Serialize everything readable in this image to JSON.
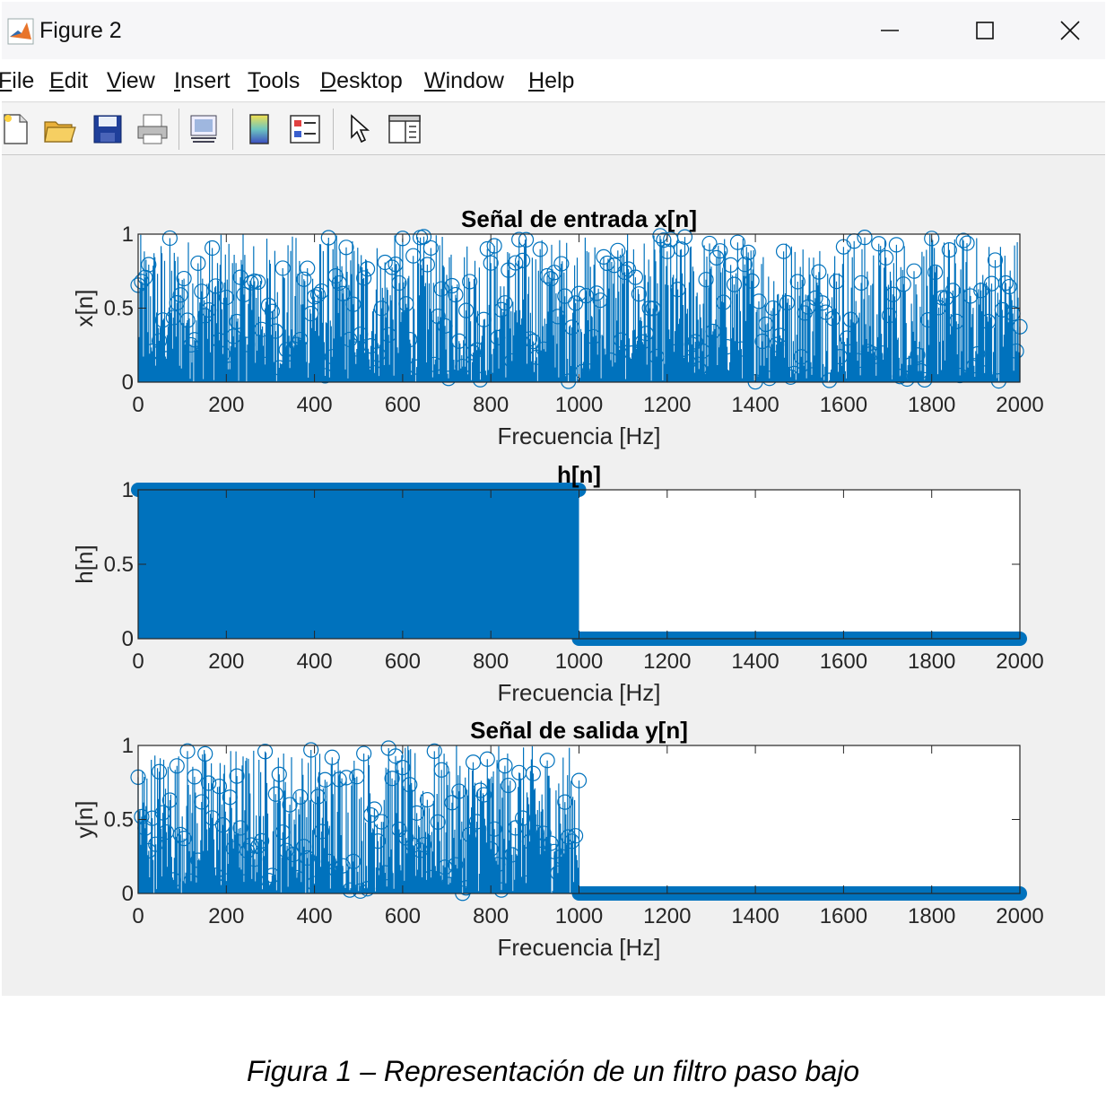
{
  "window": {
    "title": "Figure 2",
    "minimize_glyph": "—",
    "maximize_glyph": "☐",
    "close_glyph": "✕"
  },
  "menu": [
    {
      "label": "File",
      "key": "F"
    },
    {
      "label": "Edit",
      "key": "E"
    },
    {
      "label": "View",
      "key": "V"
    },
    {
      "label": "Insert",
      "key": "I"
    },
    {
      "label": "Tools",
      "key": "T"
    },
    {
      "label": "Desktop",
      "key": "D"
    },
    {
      "label": "Window",
      "key": "W"
    },
    {
      "label": "Help",
      "key": "H"
    }
  ],
  "toolbar": {
    "icons": [
      "new-figure-icon",
      "open-file-icon",
      "save-icon",
      "print-icon",
      "link-plot-icon",
      "colorbar-icon",
      "legend-icon",
      "edit-plot-arrow-icon",
      "property-inspector-icon"
    ]
  },
  "colors": {
    "stem": "#0072bd",
    "axes_bg": "#ffffff",
    "figure_bg": "#f0f0f0"
  },
  "chart_data": [
    {
      "type": "scatter",
      "style": "stem",
      "title": "Señal de entrada x[n]",
      "xlabel": "Frecuencia [Hz]",
      "ylabel": "x[n]",
      "xlim": [
        0,
        2000
      ],
      "ylim": [
        0,
        1
      ],
      "xticks": [
        "0",
        "200",
        "400",
        "600",
        "800",
        "1000",
        "1200",
        "1400",
        "1600",
        "1800",
        "2000"
      ],
      "yticks": [
        "0",
        "0.5",
        "1"
      ],
      "series": [
        {
          "x_range": [
            0,
            2000
          ],
          "values": "random uniform in [0,1] at every integer frequency 0–2000"
        }
      ]
    },
    {
      "type": "scatter",
      "style": "stem",
      "title": "h[n]",
      "xlabel": "Frecuencia [Hz]",
      "ylabel": "h[n]",
      "xlim": [
        0,
        2000
      ],
      "ylim": [
        0,
        1
      ],
      "xticks": [
        "0",
        "200",
        "400",
        "600",
        "800",
        "1000",
        "1200",
        "1400",
        "1600",
        "1800",
        "2000"
      ],
      "yticks": [
        "0",
        "0.5",
        "1"
      ],
      "series": [
        {
          "x_range": [
            0,
            1000
          ],
          "value": 1
        },
        {
          "x_range": [
            1001,
            2000
          ],
          "value": 0
        }
      ]
    },
    {
      "type": "scatter",
      "style": "stem",
      "title": "Señal de salida y[n]",
      "xlabel": "Frecuencia [Hz]",
      "ylabel": "y[n]",
      "xlim": [
        0,
        2000
      ],
      "ylim": [
        0,
        1
      ],
      "xticks": [
        "0",
        "200",
        "400",
        "600",
        "800",
        "1000",
        "1200",
        "1400",
        "1600",
        "1800",
        "2000"
      ],
      "yticks": [
        "0",
        "0.5",
        "1"
      ],
      "series": [
        {
          "x_range": [
            0,
            1000
          ],
          "values": "random uniform in [0,1]"
        },
        {
          "x_range": [
            1001,
            2000
          ],
          "value": 0
        }
      ]
    }
  ],
  "caption": "Figura 1 – Representación de un filtro paso bajo"
}
